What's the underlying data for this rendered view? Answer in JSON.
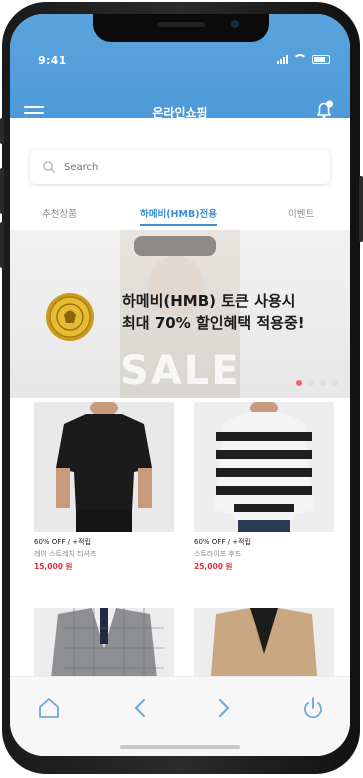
{
  "status": {
    "time": "9:41"
  },
  "header": {
    "title": "온라인쇼핑",
    "notification_count": "1"
  },
  "search": {
    "placeholder": "Search"
  },
  "tabs": [
    {
      "label": "추천상품",
      "active": false
    },
    {
      "label": "하메비(HMB)전용",
      "active": true
    },
    {
      "label": "이벤트",
      "active": false
    }
  ],
  "banner": {
    "line1": "하메비(HMB) 토큰 사용시",
    "line2": "최대 70% 할인혜택 적용중!",
    "background_text": "SALE",
    "slide_count": 4,
    "active_slide": 1
  },
  "products": [
    {
      "tag": "60% OFF / +적립",
      "name": "레이 스트레치 티셔츠",
      "price": "15,000 원"
    },
    {
      "tag": "60% OFF / +적립",
      "name": "스트라이프 후드",
      "price": "25,000 원"
    },
    {
      "tag": "",
      "name": "",
      "price": ""
    },
    {
      "tag": "",
      "name": "",
      "price": ""
    }
  ],
  "bottom_nav": [
    "home-icon",
    "back-icon",
    "forward-icon",
    "power-icon"
  ],
  "colors": {
    "header": "#5aa4de",
    "accent": "#3a8fd6",
    "price": "#e0303b",
    "slide_active": "#ff5f6d"
  }
}
